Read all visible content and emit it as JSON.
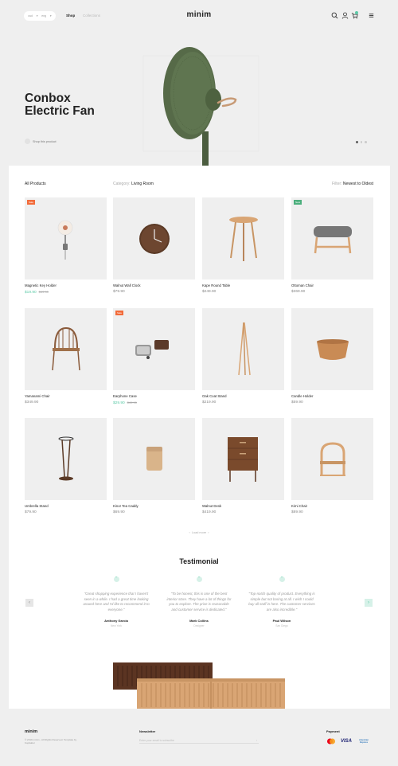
{
  "header": {
    "selector_1": "usd",
    "selector_2": "eng",
    "nav": [
      "Shop",
      "Collections"
    ],
    "logo": "minim"
  },
  "hero": {
    "title": "Conbox Electric Fan",
    "shop_link": "Shop this product"
  },
  "filters": {
    "all": "All Products",
    "category_label": "Category:",
    "category_value": "Living Room",
    "filter_label": "Filter:",
    "filter_value": "Newest to Oldest"
  },
  "products": [
    {
      "name": "Magnetic Key Holder",
      "price": "$19.90",
      "old_price": "$49.90",
      "badge": "Sale"
    },
    {
      "name": "Walnut Wall Clock",
      "price": "$79.90",
      "old_price": "",
      "badge": ""
    },
    {
      "name": "Kape Round Table",
      "price": "$249.90",
      "old_price": "",
      "badge": ""
    },
    {
      "name": "Ottoman Chair",
      "price": "$369.90",
      "old_price": "",
      "badge": "New"
    },
    {
      "name": "Yamanami Chair",
      "price": "$349.90",
      "old_price": "",
      "badge": ""
    },
    {
      "name": "Earphone Case",
      "price": "$29.90",
      "old_price": "$49.90",
      "badge": "Sale"
    },
    {
      "name": "Oak Coat Stand",
      "price": "$219.90",
      "old_price": "",
      "badge": ""
    },
    {
      "name": "Candle Holder",
      "price": "$59.90",
      "old_price": "",
      "badge": ""
    },
    {
      "name": "Umbrella Stand",
      "price": "$79.90",
      "old_price": "",
      "badge": ""
    },
    {
      "name": "Kinor Tea Caddy",
      "price": "$69.90",
      "old_price": "",
      "badge": ""
    },
    {
      "name": "Walnut Desk",
      "price": "$419.90",
      "old_price": "",
      "badge": ""
    },
    {
      "name": "Kirni Chair",
      "price": "$89.90",
      "old_price": "",
      "badge": ""
    }
  ],
  "pager": "Load more",
  "testimonial": {
    "title": "Testimonial",
    "items": [
      {
        "text": "\"Great shopping experience that I haven't seen in a while. I had a great time looking around here and I'd like to recommend it to everyone.\"",
        "name": "Anthony Garcia",
        "role": "New York"
      },
      {
        "text": "\"To be honest, this is one of the best interior store. They have a lot of things for you to explore. The price is reasonable and customer service is dedicated.\"",
        "name": "Mark Collins",
        "role": "Designer"
      },
      {
        "text": "\"Top-notch quality of product. Everything is simple but not boring at all. I wish I could buy all stuff in here. The customer services are also incredible.\"",
        "name": "Paul Wilson",
        "role": "San Diego"
      }
    ]
  },
  "footer": {
    "logo": "minim",
    "copyright": "© 2019 minim - All Rights Reserved. Template by Kopfaktor",
    "newsletter_title": "Newsletter",
    "newsletter_placeholder": "Enter your email to subscribe",
    "payment_title": "Payment",
    "payment_methods": [
      "Mastercard",
      "VISA",
      "American Express"
    ]
  },
  "colors": {
    "accent": "#5cc9a7",
    "sale": "#f26b3a",
    "new": "#4caf7d"
  }
}
